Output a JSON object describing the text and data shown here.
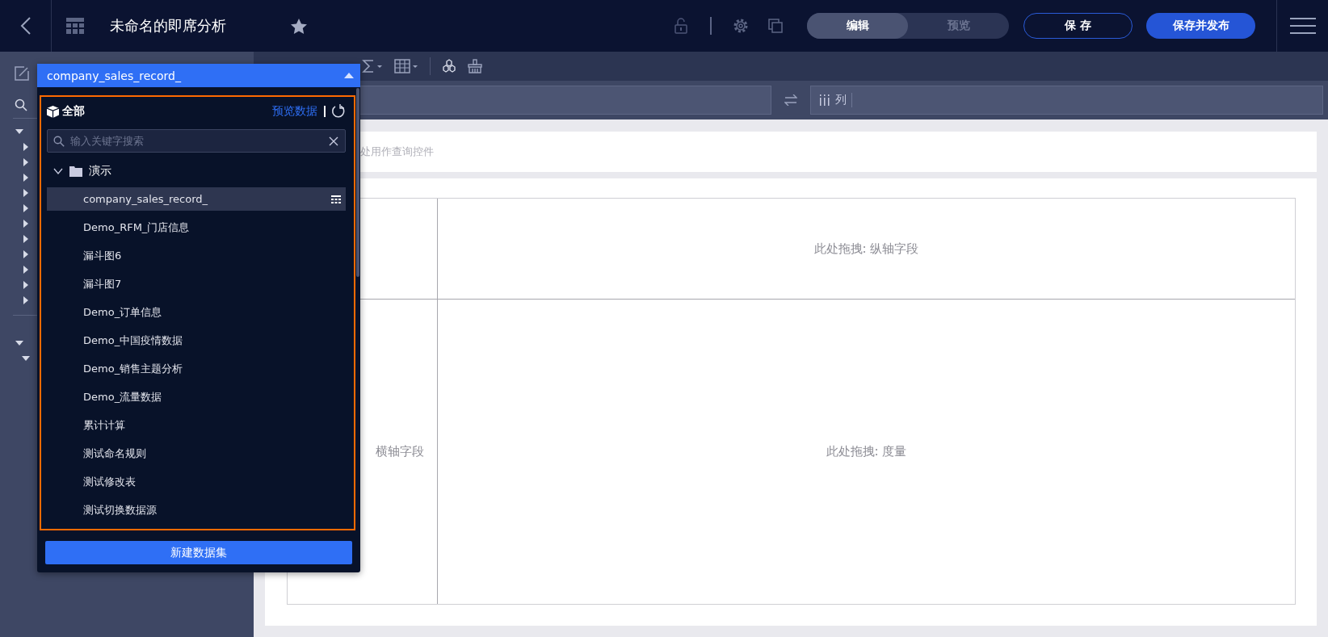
{
  "header": {
    "title": "未命名的即席分析",
    "mode_tabs": [
      {
        "label": "编辑",
        "selected": true
      },
      {
        "label": "预览",
        "selected": false
      }
    ],
    "buttons": [
      {
        "label": "保 存",
        "kind": "outline"
      },
      {
        "label": "保存并发布",
        "kind": "primary"
      }
    ]
  },
  "field_tree": [
    {
      "expanded": true,
      "children": [
        {
          "expanded": false
        },
        {
          "expanded": false
        },
        {
          "expanded": false
        },
        {
          "expanded": false
        },
        {
          "expanded": false
        },
        {
          "expanded": false
        },
        {
          "expanded": false
        },
        {
          "expanded": false
        },
        {
          "expanded": false
        },
        {
          "expanded": false
        },
        {
          "expanded": false
        }
      ]
    },
    {
      "expanded": true,
      "children": [
        {
          "expanded": true
        }
      ]
    }
  ],
  "shelves": {
    "columns_label": "列"
  },
  "canvas": {
    "filter_hint": "处用作查询控件",
    "y_axis_hint": "此处拖拽: 纵轴字段",
    "x_axis_hint": "横轴字段",
    "measure_hint": "此处拖拽: 度量"
  },
  "dataset_picker": {
    "selected": "company_sales_record_",
    "root_label": "全部",
    "preview_link": "预览数据",
    "search": {
      "placeholder": "输入关键字搜索"
    },
    "folder": {
      "label": "演示",
      "expanded": true,
      "children": [
        {
          "label": "company_sales_record_",
          "selected": true
        },
        {
          "label": "Demo_RFM_门店信息",
          "selected": false
        },
        {
          "label": "漏斗图6",
          "selected": false
        },
        {
          "label": "漏斗图7",
          "selected": false
        },
        {
          "label": "Demo_订单信息",
          "selected": false
        },
        {
          "label": "Demo_中国疫情数据",
          "selected": false
        },
        {
          "label": "Demo_销售主题分析",
          "selected": false
        },
        {
          "label": "Demo_流量数据",
          "selected": false
        },
        {
          "label": "累计计算",
          "selected": false
        },
        {
          "label": "测试命名规则",
          "selected": false
        },
        {
          "label": "测试修改表",
          "selected": false
        },
        {
          "label": "测试切换数据源",
          "selected": false
        }
      ]
    },
    "new_button": "新建数据集"
  }
}
